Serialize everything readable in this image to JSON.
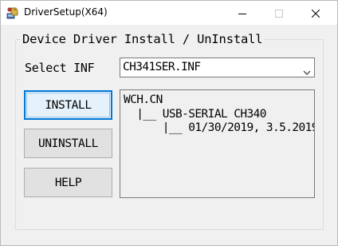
{
  "window": {
    "title": "DriverSetup(X64)",
    "app_icon": "driver-setup-icon",
    "controls": {
      "minimize_icon": "minimize-icon",
      "maximize_icon": "maximize-icon",
      "close_icon": "close-icon"
    }
  },
  "group": {
    "label": "Device Driver Install / UnInstall"
  },
  "select_inf": {
    "label": "Select INF",
    "value": "CH341SER.INF",
    "arrow_icon": "chevron-down-icon"
  },
  "buttons": {
    "install": "INSTALL",
    "uninstall": "UNINSTALL",
    "help": "HELP"
  },
  "info": {
    "lines": [
      "WCH.CN",
      "  |__ USB-SERIAL CH340",
      "      |__ 01/30/2019, 3.5.2019"
    ]
  },
  "colors": {
    "accent": "#0078d7",
    "window_bg": "#f0f0f0",
    "titlebar_bg": "#ffffff"
  }
}
